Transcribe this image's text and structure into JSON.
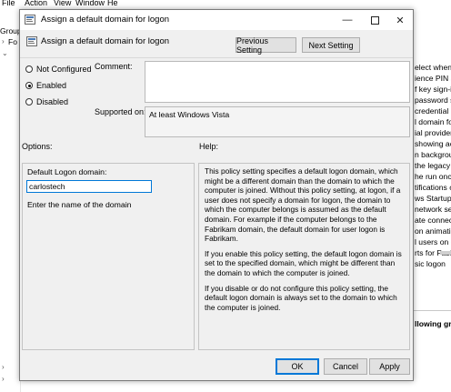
{
  "background": {
    "menu": [
      "File",
      "Action",
      "View",
      "Window",
      "He"
    ],
    "left_labels": [
      "Group",
      "Fo"
    ],
    "right_lines": [
      "elect when a",
      "ience PIN si",
      "f key sign-in",
      "password s",
      "credential p",
      "l domain for",
      "ial provider",
      "showing ac",
      "n backgrou",
      "the legacy r",
      "he run onc",
      "tifications o",
      "ws Startup s",
      "network sele",
      "ate connect",
      "on animatio",
      "l users on d",
      "rts for Fast U",
      "sic logon"
    ],
    "right_bold_text": "llowing gro"
  },
  "dialog": {
    "window_title": "Assign a default domain for logon",
    "heading": "Assign a default domain for logon",
    "prev_button": "Previous Setting",
    "next_button": "Next Setting",
    "radios": [
      {
        "label": "Not Configured",
        "selected": false
      },
      {
        "label": "Enabled",
        "selected": true
      },
      {
        "label": "Disabled",
        "selected": false
      }
    ],
    "comment_label": "Comment:",
    "supported_label": "Supported on:",
    "supported_value": "At least Windows Vista",
    "options_label": "Options:",
    "help_label": "Help:",
    "options": {
      "field_label": "Default Logon domain:",
      "field_value": "carlostech",
      "hint": "Enter the name of the domain"
    },
    "help_paragraphs": [
      "This policy setting specifies a default logon domain, which might be a different domain than the domain to which the computer is joined. Without this policy setting, at logon, if a user does not specify a domain for logon, the domain to which the computer belongs is assumed as the default domain. For example if the computer belongs to the Fabrikam domain, the default domain for user logon is Fabrikam.",
      "If you enable this policy setting, the default logon domain is set to the specified domain, which might be different than the domain to which the computer is joined.",
      "If you disable or do not configure  this policy setting, the default logon domain is always set to the  domain to which the computer is joined."
    ],
    "ok_button": "OK",
    "cancel_button": "Cancel",
    "apply_button": "Apply"
  },
  "colors": {
    "accent": "#0078d7",
    "dialog_bg": "#f0f0f0"
  }
}
